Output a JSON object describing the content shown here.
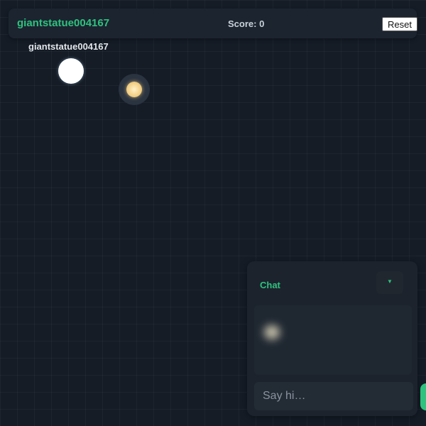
{
  "header": {
    "username": "giantstatue004167",
    "score_label": "Score:",
    "score_value": "0",
    "reset_label": "Reset"
  },
  "player": {
    "name": "giantstatue004167"
  },
  "chat": {
    "title": "Chat",
    "toggle_icon": "triangle-down",
    "input_placeholder": "Say hi…"
  },
  "colors": {
    "accent": "#2ec27e",
    "background": "#151c26",
    "panel": "#1c232d",
    "player": "#ffffff",
    "orb": "#f4d28a"
  }
}
